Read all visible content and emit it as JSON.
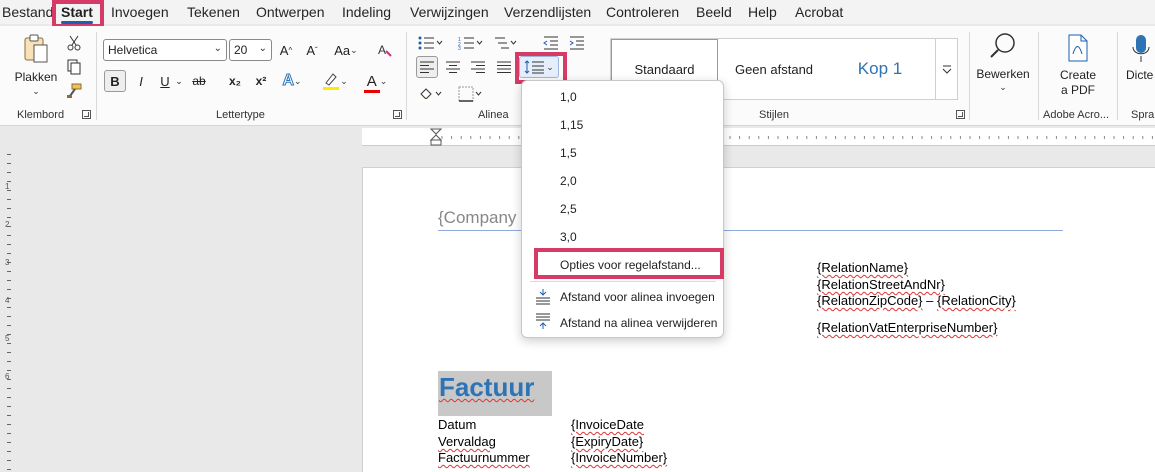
{
  "menu": {
    "items": [
      "Bestand",
      "Start",
      "Invoegen",
      "Tekenen",
      "Ontwerpen",
      "Indeling",
      "Verwijzingen",
      "Verzendlijsten",
      "Controleren",
      "Beeld",
      "Help",
      "Acrobat"
    ],
    "active": "Start"
  },
  "ribbon": {
    "clipboard": {
      "label": "Klembord",
      "paste": "Plakken"
    },
    "font": {
      "label": "Lettertype",
      "name": "Helvetica",
      "size": "20",
      "bold": "B",
      "italic": "I",
      "underline": "U",
      "strike": "ab",
      "subscript": "x₂",
      "superscript": "x²",
      "font_color_glyph": "A",
      "case_glyph": "Aa",
      "grow": "A^",
      "shrink": "Aˇ"
    },
    "paragraph": {
      "label": "Alinea"
    },
    "styles": {
      "label": "Stijlen",
      "items": [
        "Standaard",
        "Geen afstand",
        "Kop 1"
      ]
    },
    "editing": {
      "label": "Bewerken"
    },
    "acrobat": {
      "label": "Adobe Acro...",
      "create_line1": "Create",
      "create_line2": "a PDF"
    },
    "voice": {
      "label": "Spra",
      "dictate": "Dicte"
    }
  },
  "line_spacing_menu": {
    "options": [
      "1,0",
      "1,15",
      "1,5",
      "2,0",
      "2,5",
      "3,0"
    ],
    "more_options": "Opties voor regelafstand...",
    "add_space_before": "Afstand voor alinea invoegen",
    "remove_space_after": "Afstand na alinea verwijderen"
  },
  "document": {
    "company": "{Company",
    "relation_name": "{RelationName}",
    "relation_street": "{RelationStreetAndNr}",
    "relation_zip": "{RelationZipCode}",
    "relation_dash": "–",
    "relation_city": "{RelationCity}",
    "relation_vat": "{RelationVatEnterpriseNumber}",
    "heading": "Factuur",
    "rows": [
      {
        "label": "Datum",
        "value": "{InvoiceDate"
      },
      {
        "label": "Vervaldag",
        "value": "{ExpiryDate}"
      },
      {
        "label": "Factuurnummer",
        "value": "{InvoiceNumber}"
      }
    ]
  },
  "colors": {
    "accent_blue": "#1a5fb4",
    "highlight_box": "#d63a66",
    "heading_blue": "#2e74b5",
    "heading_bg": "#c8c8c8"
  },
  "vertical_ruler_numbers": [
    "1",
    "2",
    "3",
    "4",
    "5",
    "6"
  ]
}
